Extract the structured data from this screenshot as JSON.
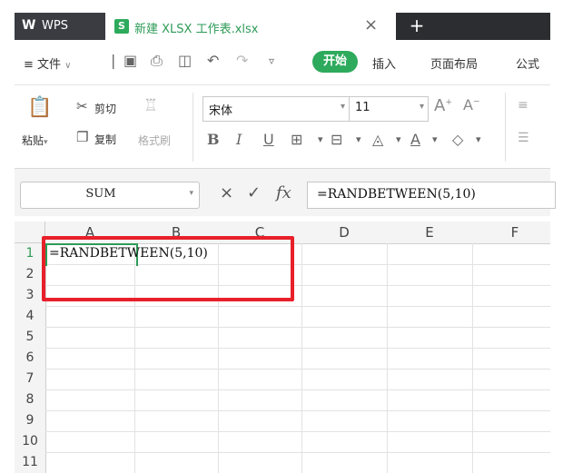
{
  "titlebar": {
    "app_logo": "W",
    "app_name": "WPS",
    "doc_icon": "S",
    "doc_title": "新建 XLSX 工作表.xlsx",
    "close_glyph": "×",
    "new_tab_glyph": "+"
  },
  "menubar": {
    "file_menu": "≡ 文件",
    "start_tab": "开始",
    "insert_tab": "插入",
    "layout_tab": "页面布局",
    "formula_tab": "公式"
  },
  "ribbon": {
    "paste": "粘贴",
    "cut": "剪切",
    "copy": "复制",
    "format_painter": "格式刷",
    "font_name": "宋体",
    "font_size": "11",
    "bold": "B",
    "italic": "I",
    "underline": "U",
    "grow_font": "A",
    "shrink_font": "A"
  },
  "formulabar": {
    "name_box": "SUM",
    "cancel_glyph": "×",
    "confirm_glyph": "✓",
    "fx": "fx",
    "formula": "=RANDBETWEEN(5,10)"
  },
  "grid": {
    "columns": [
      "A",
      "B",
      "C",
      "D",
      "E",
      "F"
    ],
    "rows": [
      "1",
      "2",
      "3",
      "4",
      "5",
      "6",
      "7",
      "8",
      "9",
      "10",
      "11"
    ],
    "cell_a1": "=RANDBETWEEN(5,10)"
  },
  "colors": {
    "accent_green": "#2eaa5c",
    "highlight_red": "#e8202a",
    "titlebar_dark": "#2b2d31"
  }
}
